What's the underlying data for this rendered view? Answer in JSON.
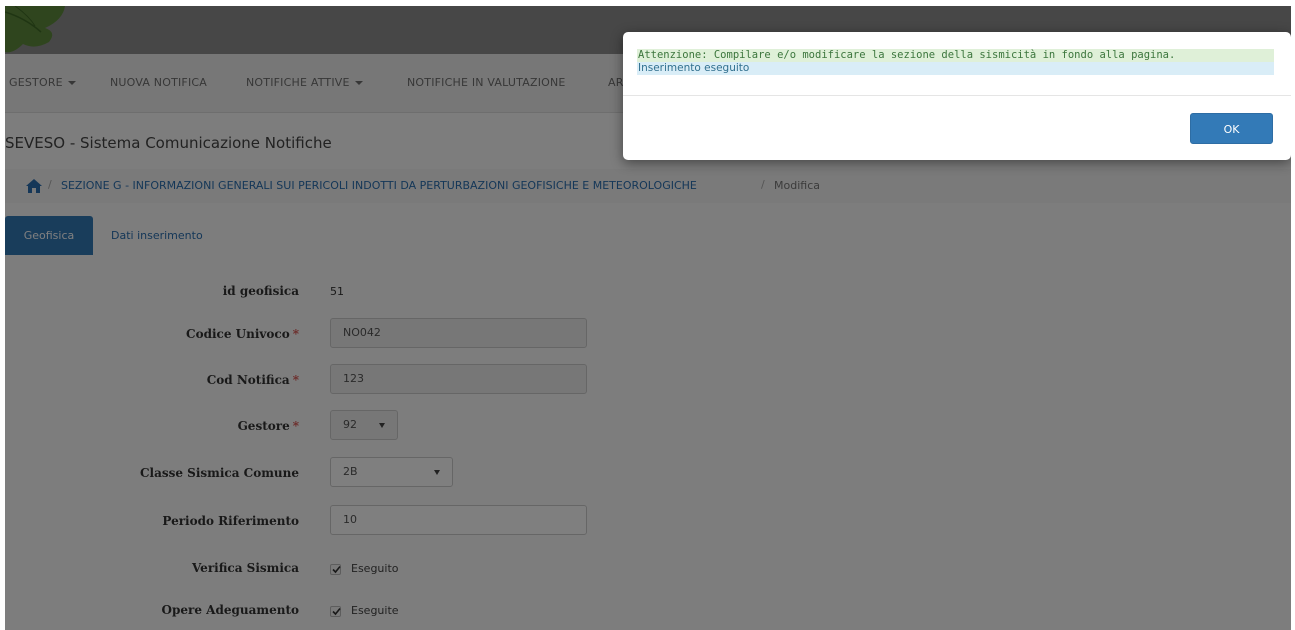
{
  "navbar": {
    "items": [
      {
        "label": "GESTORE",
        "dropdown": true
      },
      {
        "label": "NUOVA NOTIFICA",
        "dropdown": false
      },
      {
        "label": "NOTIFICHE ATTIVE",
        "dropdown": true
      },
      {
        "label": "NOTIFICHE IN VALUTAZIONE",
        "dropdown": false
      },
      {
        "label": "AR",
        "dropdown": false
      }
    ]
  },
  "page_title": "SEVESO - Sistema Comunicazione Notifiche",
  "breadcrumb": {
    "home_icon": "home-icon",
    "section": "SEZIONE G - INFORMAZIONI GENERALI SUI PERICOLI INDOTTI DA PERTURBAZIONI GEOFISICHE E METEOROLOGICHE",
    "separator": "/",
    "current": "Modifica"
  },
  "tabs": [
    {
      "label": "Geofisica",
      "active": true
    },
    {
      "label": "Dati inserimento",
      "active": false
    }
  ],
  "form": {
    "id_geofisica": {
      "label": "id geofisica",
      "value": "51"
    },
    "codice_univoco": {
      "label": "Codice Univoco",
      "required_mark": "*",
      "value": "NO042"
    },
    "cod_notifica": {
      "label": "Cod Notifica",
      "required_mark": "*",
      "value": "123"
    },
    "gestore": {
      "label": "Gestore",
      "required_mark": "*",
      "value": "92"
    },
    "classe_sismica": {
      "label": "Classe Sismica Comune",
      "value": "2B"
    },
    "periodo_riferimento": {
      "label": "Periodo Riferimento",
      "value": "10"
    },
    "verifica_sismica": {
      "label": "Verifica Sismica",
      "checked": true,
      "option": "Eseguito"
    },
    "opere_adeguamento": {
      "label": "Opere Adeguamento",
      "checked": true,
      "option": "Eseguite"
    }
  },
  "modal": {
    "warning": "Attenzione: Compilare e/o modificare la sezione della sismicità in fondo alla pagina.",
    "info": "Inserimento eseguito",
    "ok_label": "OK"
  },
  "colors": {
    "primary": "#337ab7",
    "link": "#2a6fb0",
    "required": "#d9534f",
    "warning_bg": "#dff0d8",
    "info_bg": "#d9edf7"
  }
}
